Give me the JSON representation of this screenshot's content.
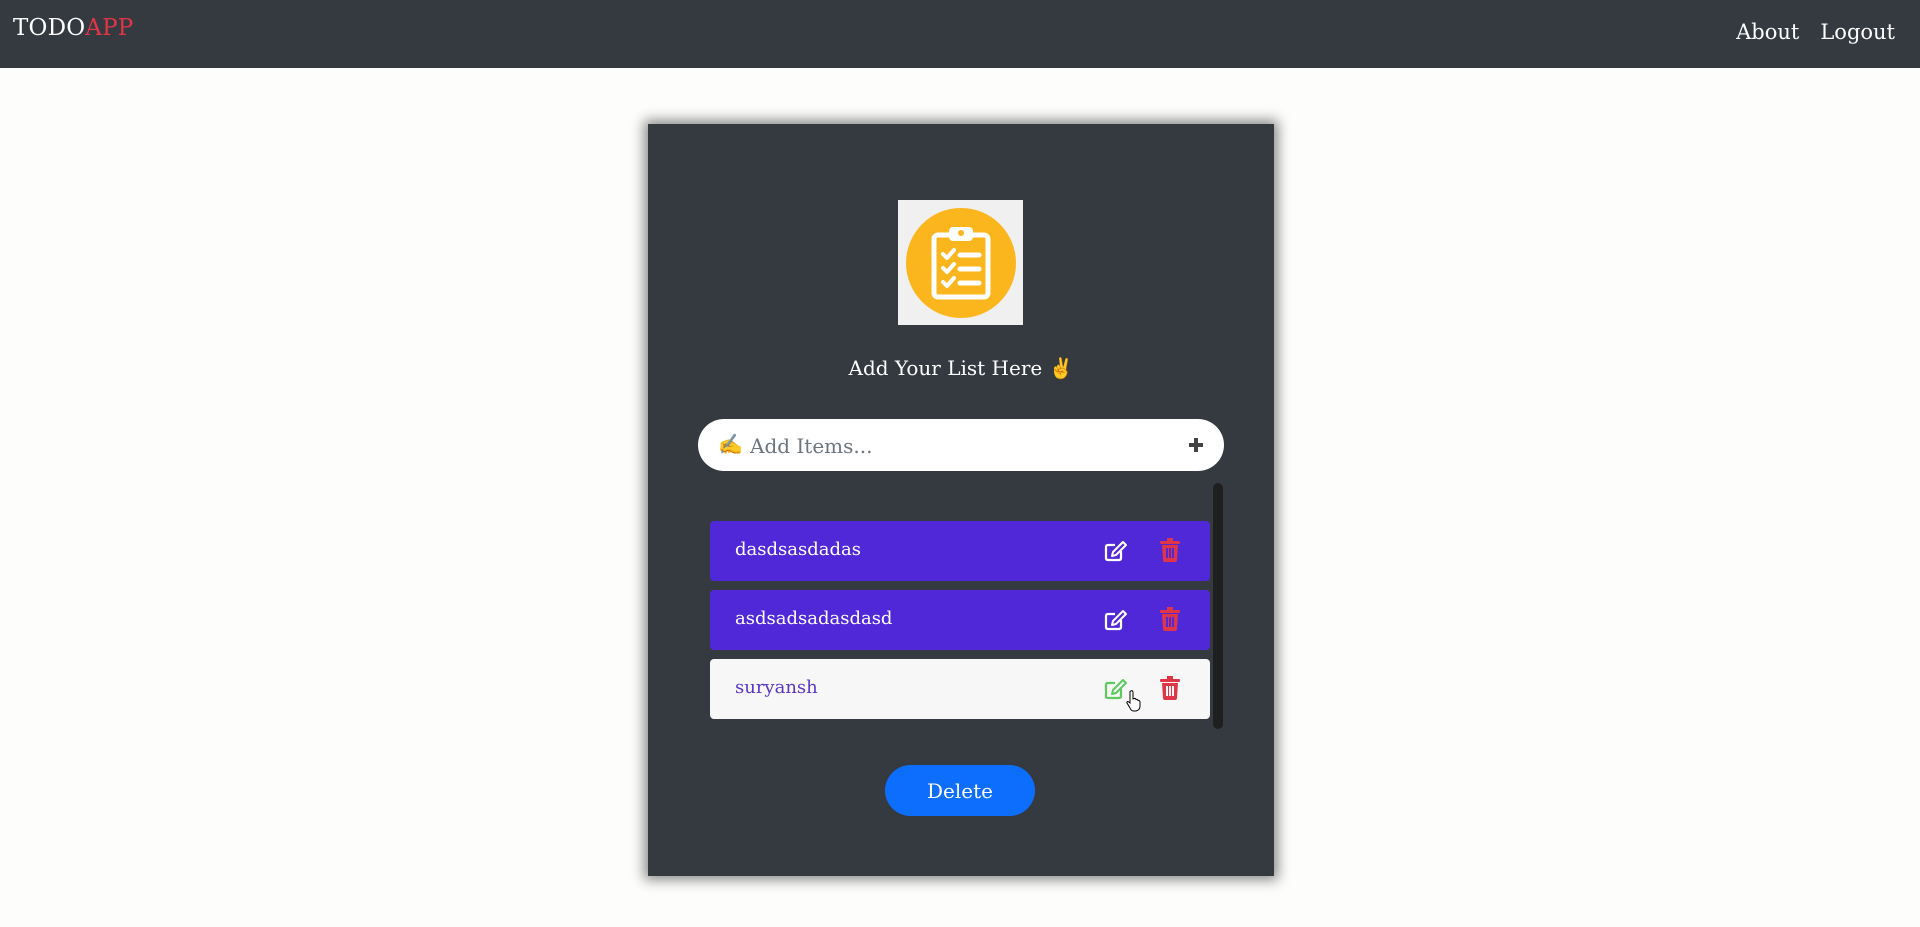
{
  "navbar": {
    "brand_main": "TODO",
    "brand_accent": "APP",
    "links": {
      "about": "About",
      "logout": "Logout"
    }
  },
  "card": {
    "logo_icon": "clipboard-checklist-icon",
    "heading": "Add Your List Here ✌",
    "add_input": {
      "prefix_emoji": "✍",
      "placeholder": "Add Items...",
      "value": ""
    },
    "add_button_icon": "plus-icon",
    "items": [
      {
        "text": "dasdsasdadas",
        "style": "purple"
      },
      {
        "text": "asdsadsadasdasd",
        "style": "purple"
      },
      {
        "text": "suryansh",
        "style": "light"
      }
    ],
    "delete_label": "Delete"
  },
  "colors": {
    "navbar_bg": "#343a40",
    "brand_accent": "#e03546",
    "item_purple": "#5128d8",
    "item_light": "#f7f7f8",
    "delete_button": "#0d6efd",
    "trash_red": "#e03546",
    "edit_hover_green": "#5ec95e",
    "logo_yellow": "#fbb61d"
  }
}
